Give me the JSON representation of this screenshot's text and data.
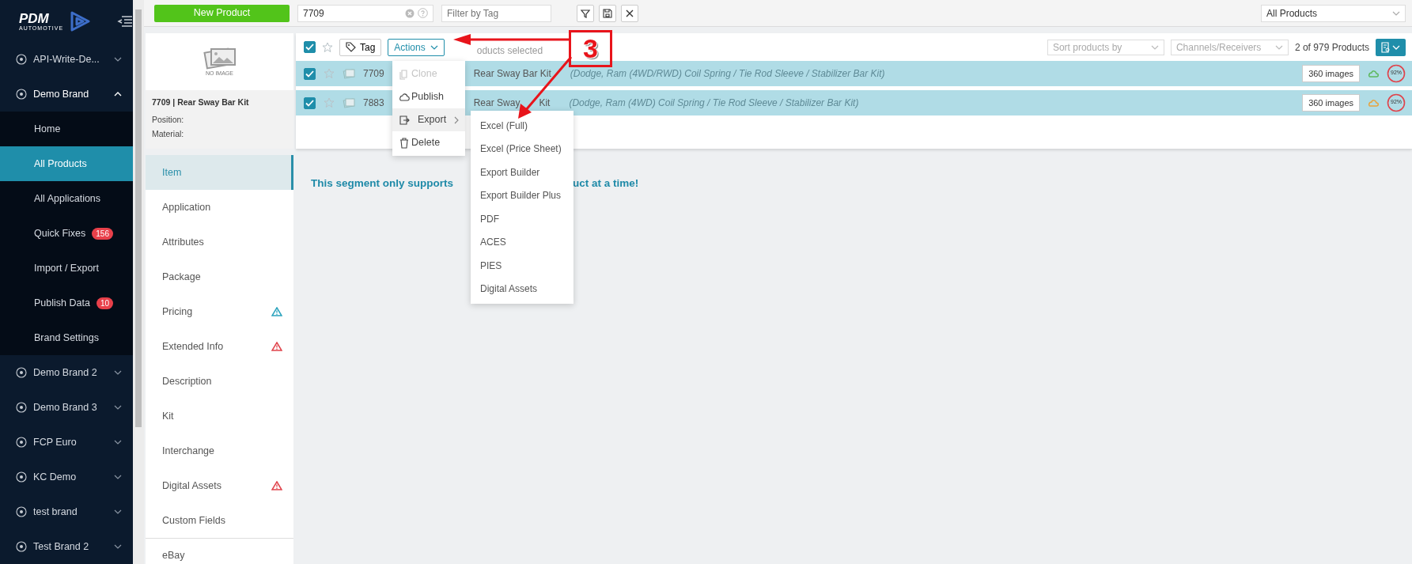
{
  "sidebar": {
    "logo": "PDM",
    "logo_sub": "AUTOMOTIVE",
    "brands": [
      {
        "label": "API-Write-De...",
        "expanded": false
      },
      {
        "label": "Demo Brand",
        "expanded": true,
        "children": [
          {
            "label": "Home",
            "selected": false
          },
          {
            "label": "All Products",
            "selected": true
          },
          {
            "label": "All Applications",
            "selected": false
          },
          {
            "label": "Quick Fixes",
            "selected": false,
            "badge": "156"
          },
          {
            "label": "Import / Export",
            "selected": false
          },
          {
            "label": "Publish Data",
            "selected": false,
            "badge": "10"
          },
          {
            "label": "Brand Settings",
            "selected": false
          }
        ]
      },
      {
        "label": "Demo Brand 2",
        "expanded": false
      },
      {
        "label": "Demo Brand 3",
        "expanded": false
      },
      {
        "label": "FCP Euro",
        "expanded": false
      },
      {
        "label": "KC Demo",
        "expanded": false
      },
      {
        "label": "test brand",
        "expanded": false
      },
      {
        "label": "Test Brand 2",
        "expanded": false
      }
    ]
  },
  "top_bar": {
    "new_product_button": "New Product",
    "search": {
      "value": "7709"
    },
    "tag_filter": {
      "placeholder": "Filter by Tag"
    },
    "scope_select": {
      "value": "All Products"
    }
  },
  "preview": {
    "no_image_label": "NO IMAGE",
    "title": "7709 | Rear Sway Bar Kit",
    "fields": [
      "Position:",
      "Material:"
    ]
  },
  "segments": [
    {
      "label": "Item",
      "selected": true
    },
    {
      "label": "Application",
      "selected": false
    },
    {
      "label": "Attributes",
      "selected": false
    },
    {
      "label": "Package",
      "selected": false
    },
    {
      "label": "Pricing",
      "selected": false,
      "color": "#2ba3bd"
    },
    {
      "label": "Extended Info",
      "selected": false,
      "color": "#e0434b"
    },
    {
      "label": "Description",
      "selected": false
    },
    {
      "label": "Kit",
      "selected": false
    },
    {
      "label": "Interchange",
      "selected": false
    },
    {
      "label": "Digital Assets",
      "selected": false,
      "color": "#e0434b"
    },
    {
      "label": "Custom Fields",
      "selected": false
    },
    {
      "label": "eBay",
      "selected": false
    }
  ],
  "toolbar": {
    "select_all_checked": true,
    "tag_button": "Tag",
    "actions_button": "Actions",
    "selection_text": "oducts selected",
    "sort_select": {
      "placeholder": "Sort products by"
    },
    "channels_select": {
      "placeholder": "Channels/Receivers"
    },
    "count": "2 of 979 Products"
  },
  "rows": [
    {
      "selected": true,
      "checked": true,
      "number": "7709",
      "title_parts": [
        "Rear Sway Bar Kit"
      ],
      "description": "(Dodge, Ram (4WD/RWD) Coil Spring / Tie Rod Sleeve / Stabilizer Bar Kit)",
      "images": "360 images",
      "color": "#5cb85c",
      "score": "92%"
    },
    {
      "selected": true,
      "checked": true,
      "number": "7883",
      "title_parts": [
        "Rear Sway",
        "Kit"
      ],
      "description": "(Dodge, Ram (4WD) Coil Spring / Tie Rod Sleeve / Stabilizer Bar Kit)",
      "images": "360 images",
      "color": "#e8a33d",
      "score": "92%"
    }
  ],
  "actions_menu": [
    {
      "label": "Clone",
      "kind": "clone",
      "disabled": true,
      "selected": false
    },
    {
      "label": "Publish",
      "kind": "publish",
      "disabled": false,
      "selected": false
    },
    {
      "label": "Export",
      "kind": "export",
      "disabled": false,
      "selected": true
    },
    {
      "label": "Delete",
      "kind": "delete",
      "disabled": false,
      "selected": false
    }
  ],
  "export_submenu": [
    "Excel (Full)",
    "Excel (Price Sheet)",
    "Export Builder",
    "Export Builder Plus",
    "PDF",
    "ACES",
    "PIES",
    "Digital Assets"
  ],
  "message_parts": [
    "This segment only supports",
    "uct at a time!"
  ],
  "annotation": {
    "label": "3"
  }
}
